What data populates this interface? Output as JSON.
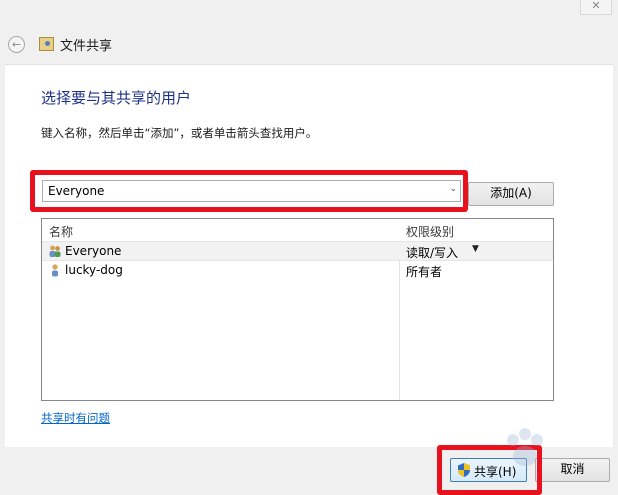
{
  "window": {
    "close_glyph": "✕"
  },
  "header": {
    "back_icon": "back-arrow-icon",
    "app_icon": "users-share-icon",
    "title": "文件共享"
  },
  "main": {
    "heading": "选择要与其共享的用户",
    "instructions": "键入名称，然后单击“添加”，或者单击箭头查找用户。",
    "name_combo": {
      "value": "Everyone",
      "arrow": "⌄"
    },
    "add_button": "添加(A)"
  },
  "user_list": {
    "columns": {
      "name": "名称",
      "permission": "权限级别"
    },
    "rows": [
      {
        "name": "Everyone",
        "permission": "读取/写入",
        "icon": "group-users-icon",
        "selected": true,
        "arrow": "▼"
      },
      {
        "name": "lucky-dog",
        "permission": "所有者",
        "icon": "user-icon",
        "selected": false
      }
    ]
  },
  "help_link": "共享时有问题",
  "footer": {
    "share_button": "共享(H)",
    "cancel_button": "取消"
  },
  "annotations": {
    "highlight_color": "#e8121e"
  },
  "colors": {
    "heading": "#1e3287",
    "link": "#0066cc"
  }
}
